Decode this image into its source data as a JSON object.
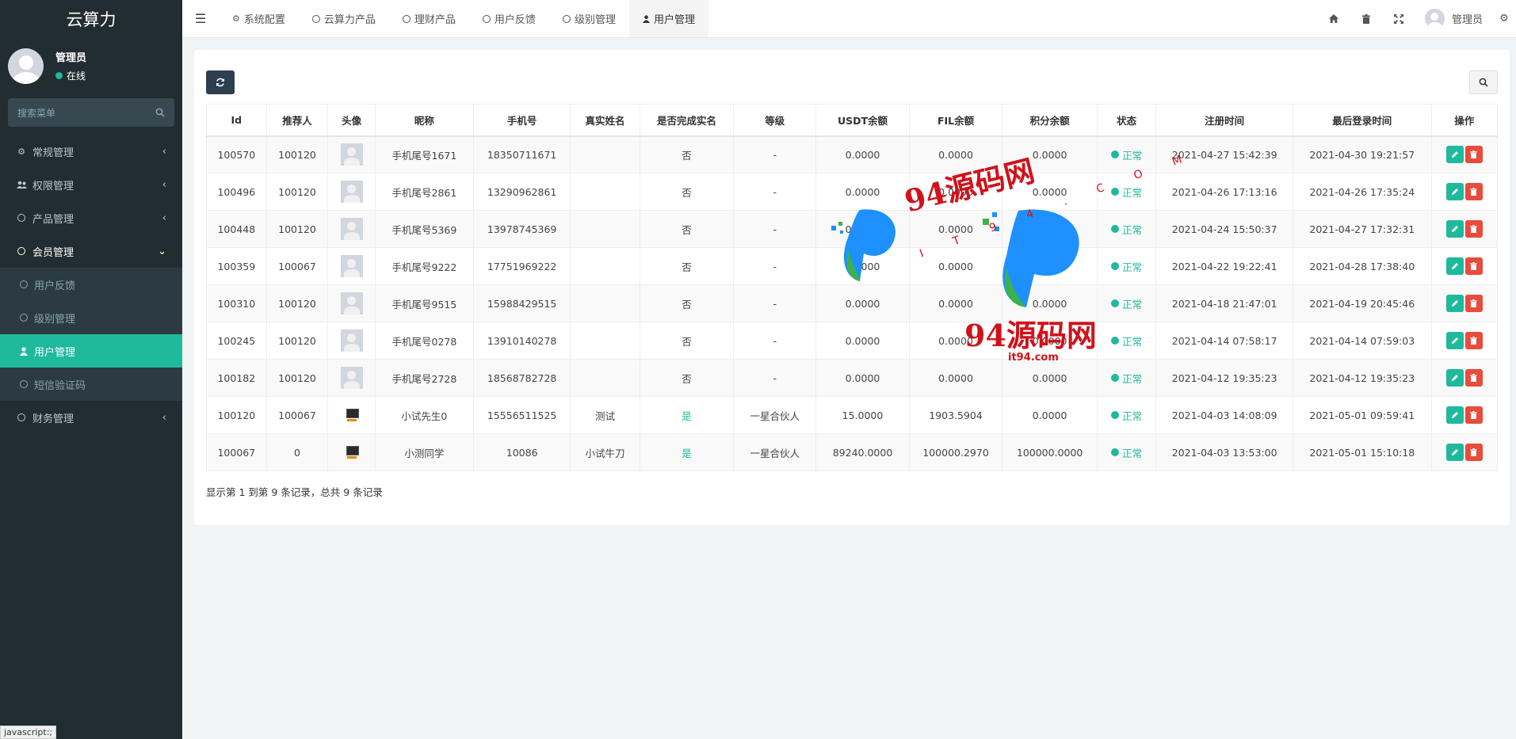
{
  "app": {
    "logo": "云算力"
  },
  "user_panel": {
    "name": "管理员",
    "status": "在线"
  },
  "sidebar": {
    "search_placeholder": "搜索菜单",
    "items": [
      {
        "label": "常规管理",
        "icon": "cogs-icon",
        "chevron": "‹"
      },
      {
        "label": "权限管理",
        "icon": "users-icon",
        "chevron": "‹"
      },
      {
        "label": "产品管理",
        "icon": "circle-icon",
        "chevron": "‹"
      },
      {
        "label": "会员管理",
        "icon": "circle-icon",
        "chevron": "⌄"
      }
    ],
    "sub_items": [
      {
        "label": "用户反馈"
      },
      {
        "label": "级别管理"
      },
      {
        "label": "用户管理"
      },
      {
        "label": "短信验证码"
      }
    ],
    "last_item": {
      "label": "财务管理",
      "chevron": "‹"
    }
  },
  "status_tip": "javascript:;",
  "topbar": {
    "tabs": [
      {
        "label": "系统配置"
      },
      {
        "label": "云算力产品"
      },
      {
        "label": "理财产品"
      },
      {
        "label": "用户反馈"
      },
      {
        "label": "级别管理"
      },
      {
        "label": "用户管理"
      }
    ],
    "user_name": "管理员"
  },
  "table": {
    "headers": [
      "Id",
      "推荐人",
      "头像",
      "昵称",
      "手机号",
      "真实姓名",
      "是否完成实名",
      "等级",
      "USDT余额",
      "FIL余额",
      "积分余额",
      "状态",
      "注册时间",
      "最后登录时间",
      "操作"
    ],
    "rows": [
      {
        "id": "100570",
        "ref": "100120",
        "avatar": "default",
        "nick": "手机尾号1671",
        "phone": "18350711671",
        "real": "",
        "verified": "否",
        "level": "-",
        "usdt": "0.0000",
        "fil": "0.0000",
        "points": "0.0000",
        "status": "正常",
        "reg": "2021-04-27 15:42:39",
        "last": "2021-04-30 19:21:57"
      },
      {
        "id": "100496",
        "ref": "100120",
        "avatar": "default",
        "nick": "手机尾号2861",
        "phone": "13290962861",
        "real": "",
        "verified": "否",
        "level": "-",
        "usdt": "0.0000",
        "fil": "0.0000",
        "points": "0.0000",
        "status": "正常",
        "reg": "2021-04-26 17:13:16",
        "last": "2021-04-26 17:35:24"
      },
      {
        "id": "100448",
        "ref": "100120",
        "avatar": "default",
        "nick": "手机尾号5369",
        "phone": "13978745369",
        "real": "",
        "verified": "否",
        "level": "-",
        "usdt": "0.0000",
        "fil": "0.0000",
        "points": "0.0000",
        "status": "正常",
        "reg": "2021-04-24 15:50:37",
        "last": "2021-04-27 17:32:31"
      },
      {
        "id": "100359",
        "ref": "100067",
        "avatar": "default",
        "nick": "手机尾号9222",
        "phone": "17751969222",
        "real": "",
        "verified": "否",
        "level": "-",
        "usdt": "0.0000",
        "fil": "0.0000",
        "points": "0.0000",
        "status": "正常",
        "reg": "2021-04-22 19:22:41",
        "last": "2021-04-28 17:38:40"
      },
      {
        "id": "100310",
        "ref": "100120",
        "avatar": "default",
        "nick": "手机尾号9515",
        "phone": "15988429515",
        "real": "",
        "verified": "否",
        "level": "-",
        "usdt": "0.0000",
        "fil": "0.0000",
        "points": "0.0000",
        "status": "正常",
        "reg": "2021-04-18 21:47:01",
        "last": "2021-04-19 20:45:46"
      },
      {
        "id": "100245",
        "ref": "100120",
        "avatar": "default",
        "nick": "手机尾号0278",
        "phone": "13910140278",
        "real": "",
        "verified": "否",
        "level": "-",
        "usdt": "0.0000",
        "fil": "0.0000",
        "points": "0.0000",
        "status": "正常",
        "reg": "2021-04-14 07:58:17",
        "last": "2021-04-14 07:59:03"
      },
      {
        "id": "100182",
        "ref": "100120",
        "avatar": "default",
        "nick": "手机尾号2728",
        "phone": "18568782728",
        "real": "",
        "verified": "否",
        "level": "-",
        "usdt": "0.0000",
        "fil": "0.0000",
        "points": "0.0000",
        "status": "正常",
        "reg": "2021-04-12 19:35:23",
        "last": "2021-04-12 19:35:23"
      },
      {
        "id": "100120",
        "ref": "100067",
        "avatar": "image",
        "nick": "小试先生0",
        "phone": "15556511525",
        "real": "测试",
        "verified": "是",
        "level": "一星合伙人",
        "usdt": "15.0000",
        "fil": "1903.5904",
        "points": "0.0000",
        "status": "正常",
        "reg": "2021-04-03 14:08:09",
        "last": "2021-05-01 09:59:41"
      },
      {
        "id": "100067",
        "ref": "0",
        "avatar": "image",
        "nick": "小测同学",
        "phone": "10086",
        "real": "小试牛刀",
        "verified": "是",
        "level": "一星合伙人",
        "usdt": "89240.0000",
        "fil": "100000.2970",
        "points": "100000.0000",
        "status": "正常",
        "reg": "2021-04-03 13:53:00",
        "last": "2021-05-01 15:10:18"
      }
    ]
  },
  "pager_info": "显示第 1 到第 9 条记录，总共 9 条记录",
  "watermark": {
    "text": "94源码网",
    "sub": "it94.com",
    "dots": "I T 9 4 . C O M"
  },
  "colors": {
    "accent": "#1fb99d",
    "sidebar_bg": "#222d32",
    "danger": "#e74c3c",
    "primary_dark": "#2c3e50"
  }
}
